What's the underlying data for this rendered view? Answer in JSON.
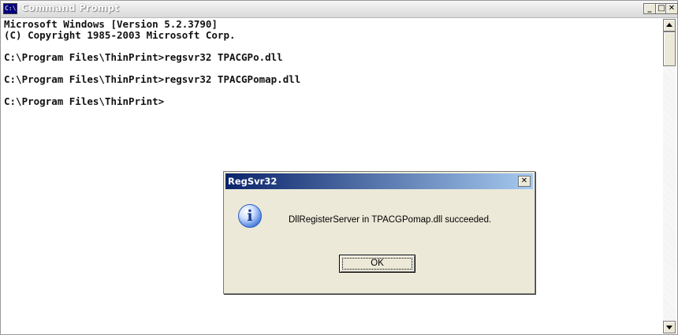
{
  "window": {
    "title": "Command Prompt",
    "icon_label": "C:\\",
    "controls": {
      "minimize": "_",
      "maximize": "□",
      "close": "✕"
    }
  },
  "console": {
    "lines": [
      "Microsoft Windows [Version 5.2.3790]",
      "(C) Copyright 1985-2003 Microsoft Corp.",
      "",
      "C:\\Program Files\\ThinPrint>regsvr32 TPACGPo.dll",
      "",
      "C:\\Program Files\\ThinPrint>regsvr32 TPACGPomap.dll",
      "",
      "C:\\Program Files\\ThinPrint>"
    ]
  },
  "dialog": {
    "title": "RegSvr32",
    "close_label": "✕",
    "icon": "info-icon",
    "icon_glyph": "i",
    "message": "DllRegisterServer in TPACGPomap.dll succeeded.",
    "ok_label": "OK"
  },
  "colors": {
    "console_background": "#ffffff",
    "console_text": "#111111",
    "dialog_background": "#ece9d8",
    "dialog_title_start": "#0a246a",
    "dialog_title_end": "#a6caf0"
  }
}
